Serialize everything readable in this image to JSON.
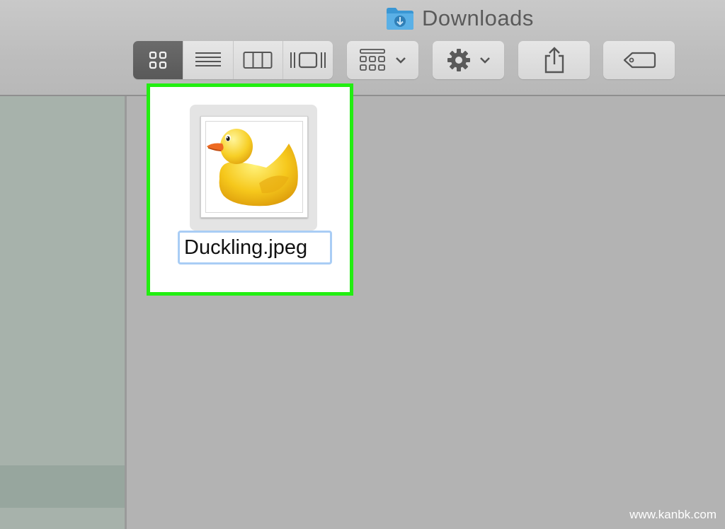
{
  "window": {
    "title": "Downloads"
  },
  "toolbar": {
    "view_modes": [
      {
        "name": "icon-view",
        "icon": "grid-icon",
        "active": true
      },
      {
        "name": "list-view",
        "icon": "list-icon",
        "active": false
      },
      {
        "name": "column-view",
        "icon": "columns-icon",
        "active": false
      },
      {
        "name": "cover-flow-view",
        "icon": "cover-flow-icon",
        "active": false
      }
    ],
    "arrange_icon": "arrange-grid-icon",
    "action_icon": "gear-icon",
    "share_icon": "share-icon",
    "tag_icon": "tag-icon"
  },
  "file": {
    "name": "Duckling.jpeg",
    "thumbnail": "rubber-duck-image",
    "selected": true
  },
  "watermark": "www.kanbk.com",
  "colors": {
    "selection_outline": "#22ee11",
    "rename_field_border": "#a9cdf5",
    "folder_blue": "#3a97d4"
  }
}
